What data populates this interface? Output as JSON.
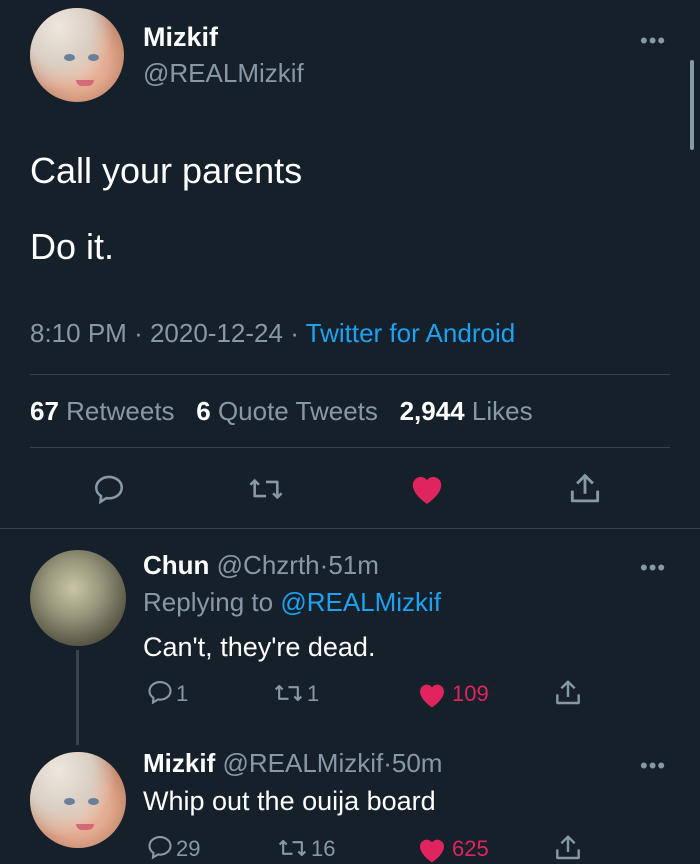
{
  "tweet": {
    "author_name": "Mizkif",
    "author_handle": "@REALMizkif",
    "text_line1": "Call your parents",
    "text_line2": "Do it.",
    "time": "8:10 PM",
    "sep1": "·",
    "date": "2020-12-24",
    "sep2": "·",
    "source": "Twitter for Android",
    "stats": {
      "retweets_count": "67",
      "retweets_label": "Retweets",
      "quotes_count": "6",
      "quotes_label": "Quote Tweets",
      "likes_count": "2,944",
      "likes_label": "Likes"
    },
    "more": "•••"
  },
  "reply1": {
    "name": "Chun",
    "handle": "@Chzrth",
    "sep": "·",
    "time": "51m",
    "replying_prefix": "Replying to",
    "replying_handle": "@REALMizkif",
    "text": "Can't, they're dead.",
    "replies": "1",
    "retweets": "1",
    "likes": "109",
    "more": "•••"
  },
  "reply2": {
    "name": "Mizkif",
    "handle": "@REALMizkif",
    "sep": "·",
    "time": "50m",
    "text": "Whip out the ouija board",
    "replies": "29",
    "retweets": "16",
    "likes": "625",
    "more": "•••"
  },
  "colors": {
    "background": "#15202b",
    "secondary_text": "#8899a6",
    "link": "#1da1f2",
    "like": "#e0245e",
    "divider": "#38444d"
  }
}
